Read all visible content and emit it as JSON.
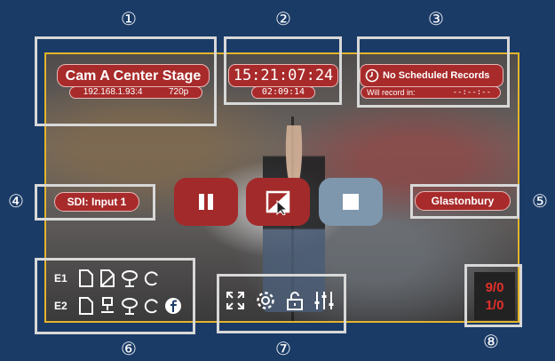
{
  "callouts": {
    "n1": "①",
    "n2": "②",
    "n3": "③",
    "n4": "④",
    "n5": "⑤",
    "n6": "⑥",
    "n7": "⑦",
    "n8": "⑧"
  },
  "camera": {
    "name": "Cam A Center Stage",
    "address": "192.168.1.93:4",
    "resolution": "720p"
  },
  "timecode": {
    "main": "15:21:07:24",
    "elapsed": "02:09:14"
  },
  "schedule": {
    "status": "No Scheduled Records",
    "will_record_label": "Will record in:",
    "will_record_value": "--:--:--"
  },
  "source": {
    "label": "SDI: Input 1"
  },
  "project": {
    "label": "Glastonbury"
  },
  "encoders": {
    "e1": "E1",
    "e2": "E2"
  },
  "counters": {
    "top": "9/0",
    "bottom": "1/0"
  },
  "colors": {
    "accent_red": "#a82a2a",
    "frame_yellow": "#e3b52a",
    "stop_gray": "#7e97ad",
    "background": "#1b3b67"
  }
}
